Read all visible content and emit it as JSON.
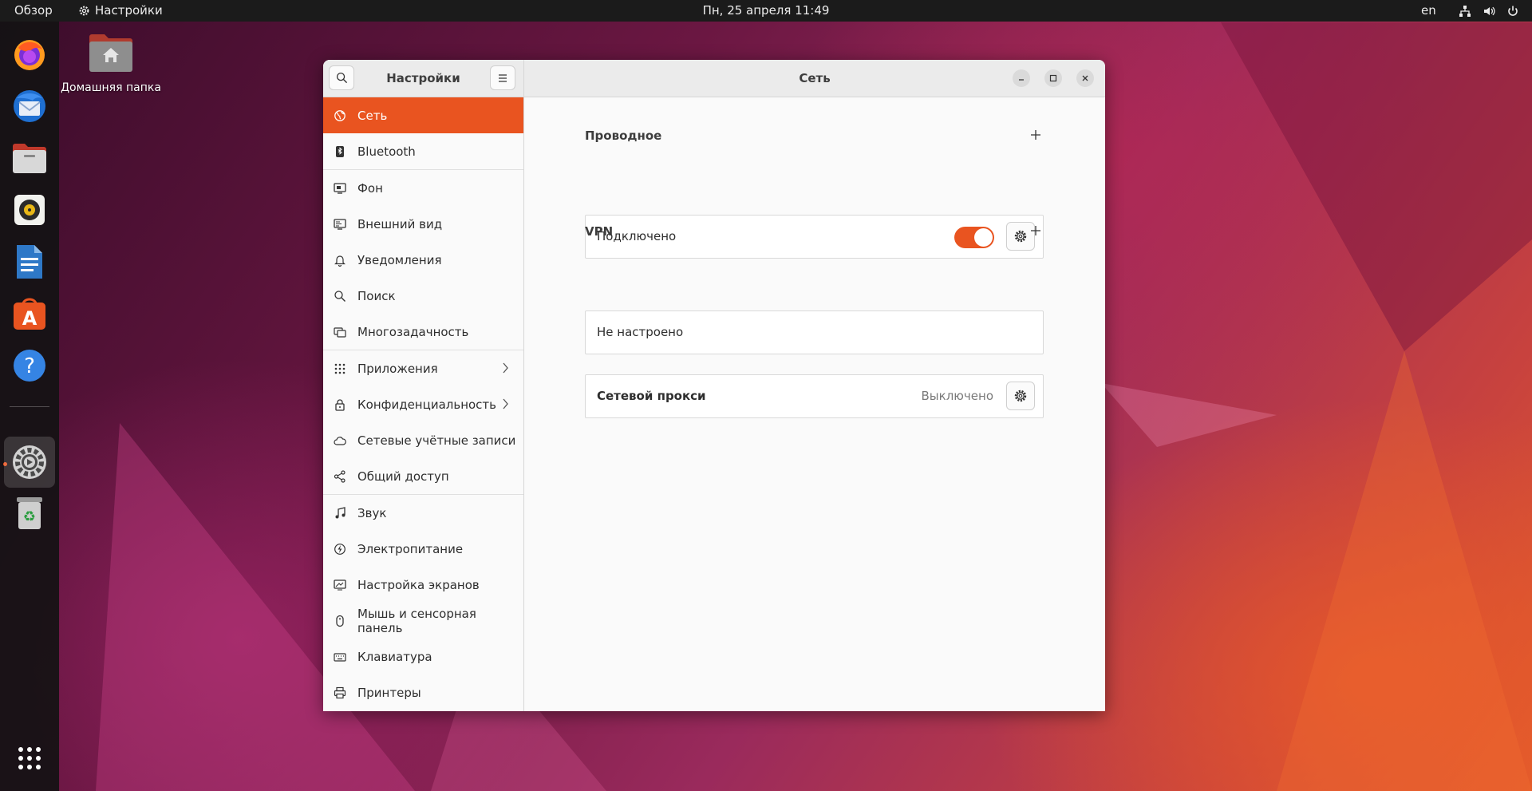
{
  "topbar": {
    "overview": "Обзор",
    "app_name": "Настройки",
    "clock": "Пн, 25 апреля  11:49",
    "lang": "en"
  },
  "dock": {
    "items": [
      {
        "name": "Firefox",
        "icon": "firefox-icon"
      },
      {
        "name": "Thunderbird",
        "icon": "thunderbird-icon"
      },
      {
        "name": "Files",
        "icon": "files-icon"
      },
      {
        "name": "Rhythmbox",
        "icon": "rhythmbox-icon"
      },
      {
        "name": "LibreOffice Writer",
        "icon": "writer-icon"
      },
      {
        "name": "Ubuntu Software",
        "icon": "software-icon"
      },
      {
        "name": "Help",
        "icon": "help-icon"
      },
      {
        "name": "Settings",
        "icon": "settings-icon",
        "active": true
      },
      {
        "name": "Trash",
        "icon": "trash-icon"
      }
    ],
    "show_apps_icon": "app-grid-icon"
  },
  "desktop": {
    "home_label": "Домашняя папка"
  },
  "window": {
    "sidebar_title": "Настройки",
    "main_title": "Сеть"
  },
  "sidebar": {
    "items": [
      {
        "label": "Сеть",
        "icon": "network-globe-icon",
        "selected": true
      },
      {
        "label": "Bluetooth",
        "icon": "bluetooth-icon"
      },
      {
        "label": "Фон",
        "icon": "background-icon"
      },
      {
        "label": "Внешний вид",
        "icon": "appearance-icon"
      },
      {
        "label": "Уведомления",
        "icon": "bell-icon"
      },
      {
        "label": "Поиск",
        "icon": "search-icon"
      },
      {
        "label": "Многозадачность",
        "icon": "multitasking-icon"
      },
      {
        "label": "Приложения",
        "icon": "apps-grid-icon",
        "chevron": true
      },
      {
        "label": "Конфиденциальность",
        "icon": "lock-icon",
        "chevron": true
      },
      {
        "label": "Сетевые учётные записи",
        "icon": "cloud-icon"
      },
      {
        "label": "Общий доступ",
        "icon": "share-icon"
      },
      {
        "label": "Звук",
        "icon": "music-note-icon"
      },
      {
        "label": "Электропитание",
        "icon": "power-icon"
      },
      {
        "label": "Настройка экранов",
        "icon": "display-icon"
      },
      {
        "label": "Мышь и сенсорная панель",
        "icon": "mouse-icon"
      },
      {
        "label": "Клавиатура",
        "icon": "keyboard-icon"
      },
      {
        "label": "Принтеры",
        "icon": "printer-icon"
      }
    ]
  },
  "network": {
    "wired_title": "Проводное",
    "wired_status": "Подключено",
    "wired_enabled": true,
    "vpn_title": "VPN",
    "vpn_status": "Не настроено",
    "proxy_label": "Сетевой прокси",
    "proxy_status": "Выключено"
  },
  "colors": {
    "accent": "#e95420",
    "topbar": "#1b1b1b"
  }
}
